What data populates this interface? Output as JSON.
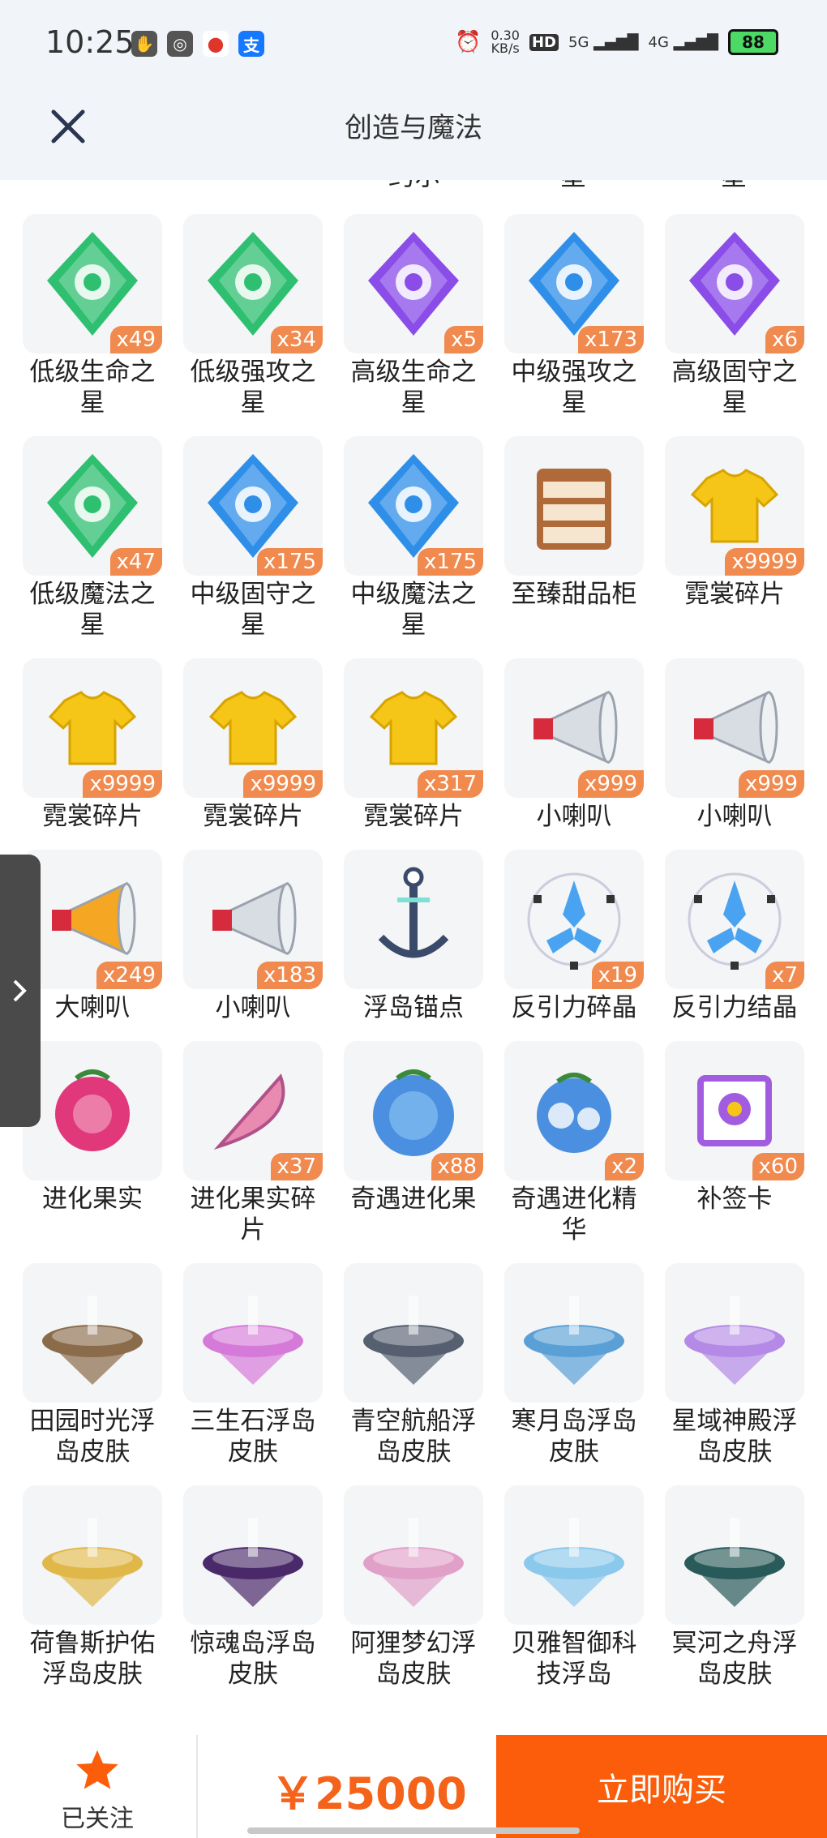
{
  "status_bar": {
    "time": "10:25",
    "net_speed": "0.30",
    "net_unit": "KB/s",
    "hd": "HD",
    "signal_5g": "5G",
    "signal_4g": "4G",
    "battery": "88",
    "left_icons": [
      "notification-hand-icon",
      "app-icon",
      "weibo-icon",
      "alipay-icon"
    ],
    "alipay_char": "支"
  },
  "header": {
    "title": "创造与魔法"
  },
  "partial_labels": [
    "约尔",
    "星",
    "星"
  ],
  "items": [
    {
      "label": "低级生命之\n星",
      "qty": "x49",
      "icon": "green-gem-heart-icon",
      "color": "#2fbf71"
    },
    {
      "label": "低级强攻之\n星",
      "qty": "x34",
      "icon": "green-gem-shield-icon",
      "color": "#2fbf71"
    },
    {
      "label": "高级生命之\n星",
      "qty": "x5",
      "icon": "purple-gem-heart-icon",
      "color": "#8a4de8"
    },
    {
      "label": "中级强攻之\n星",
      "qty": "x173",
      "icon": "blue-gem-shield-icon",
      "color": "#2f8fe8"
    },
    {
      "label": "高级固守之\n星",
      "qty": "x6",
      "icon": "purple-gem-shield-icon",
      "color": "#8a4de8"
    },
    {
      "label": "低级魔法之\n星",
      "qty": "x47",
      "icon": "green-gem-circle-icon",
      "color": "#2fbf71"
    },
    {
      "label": "中级固守之\n星",
      "qty": "x175",
      "icon": "blue-gem-shield-icon",
      "color": "#2f8fe8"
    },
    {
      "label": "中级魔法之\n星",
      "qty": "x175",
      "icon": "blue-gem-circle-icon",
      "color": "#2f8fe8"
    },
    {
      "label": "至臻甜品柜",
      "qty": "",
      "icon": "dessert-cabinet-icon",
      "color": "#b06a3a"
    },
    {
      "label": "霓裳碎片",
      "qty": "x9999",
      "icon": "yellow-shirt-icon",
      "color": "#f5c518"
    },
    {
      "label": "霓裳碎片",
      "qty": "x9999",
      "icon": "yellow-shirt-icon",
      "color": "#f5c518"
    },
    {
      "label": "霓裳碎片",
      "qty": "x9999",
      "icon": "yellow-shirt-icon",
      "color": "#f5c518"
    },
    {
      "label": "霓裳碎片",
      "qty": "x317",
      "icon": "yellow-shirt-icon",
      "color": "#f5c518"
    },
    {
      "label": "小喇叭",
      "qty": "x999",
      "icon": "megaphone-icon",
      "color": "#d8dde3"
    },
    {
      "label": "小喇叭",
      "qty": "x999",
      "icon": "megaphone-icon",
      "color": "#d8dde3"
    },
    {
      "label": "大喇叭",
      "qty": "x249",
      "icon": "rainbow-megaphone-icon",
      "color": "#f5a623"
    },
    {
      "label": "小喇叭",
      "qty": "x183",
      "icon": "megaphone-icon",
      "color": "#d8dde3"
    },
    {
      "label": "浮岛锚点",
      "qty": "",
      "icon": "anchor-icon",
      "color": "#3a4a6a"
    },
    {
      "label": "反引力碎晶",
      "qty": "x19",
      "icon": "antigravity-shard-icon",
      "color": "#4aa3f0"
    },
    {
      "label": "反引力结晶",
      "qty": "x7",
      "icon": "antigravity-crystal-icon",
      "color": "#4aa3f0"
    },
    {
      "label": "进化果实",
      "qty": "",
      "icon": "raspberry-fruit-icon",
      "color": "#e0387a"
    },
    {
      "label": "进化果实碎\n片",
      "qty": "x37",
      "icon": "fruit-slice-icon",
      "color": "#e98ab0"
    },
    {
      "label": "奇遇进化果",
      "qty": "x88",
      "icon": "blue-fruit-icon",
      "color": "#4a8fe0"
    },
    {
      "label": "奇遇进化精\n华",
      "qty": "x2",
      "icon": "blue-fruit-essence-icon",
      "color": "#4a8fe0"
    },
    {
      "label": "补签卡",
      "qty": "x60",
      "icon": "sign-card-icon",
      "color": "#a25ce0"
    },
    {
      "label": "田园时光浮\n岛皮肤",
      "qty": "",
      "icon": "island-lighthouse-icon",
      "color": "#8a6b4a"
    },
    {
      "label": "三生石浮岛\n皮肤",
      "qty": "",
      "icon": "island-blossom-icon",
      "color": "#d67ad9"
    },
    {
      "label": "青空航船浮\n岛皮肤",
      "qty": "",
      "icon": "island-ship-icon",
      "color": "#556070"
    },
    {
      "label": "寒月岛浮岛\n皮肤",
      "qty": "",
      "icon": "island-moon-icon",
      "color": "#5aa0d6"
    },
    {
      "label": "星域神殿浮\n岛皮肤",
      "qty": "",
      "icon": "island-temple-icon",
      "color": "#b48ae6"
    },
    {
      "label": "荷鲁斯护佑\n浮岛皮肤",
      "qty": "",
      "icon": "island-horus-icon",
      "color": "#e0b84a"
    },
    {
      "label": "惊魂岛浮岛\n皮肤",
      "qty": "",
      "icon": "island-haunted-icon",
      "color": "#4a2a6a"
    },
    {
      "label": "阿狸梦幻浮\n岛皮肤",
      "qty": "",
      "icon": "island-dream-icon",
      "color": "#e0a0c8"
    },
    {
      "label": "贝雅智御科\n技浮岛",
      "qty": "",
      "icon": "island-dome-icon",
      "color": "#8ac8ec"
    },
    {
      "label": "冥河之舟浮\n岛皮肤",
      "qty": "",
      "icon": "island-styx-icon",
      "color": "#2a5a5a"
    }
  ],
  "bottom_bar": {
    "follow_label": "已关注",
    "price": "￥25000",
    "buy_label": "立即购买",
    "accent": "#fb5d0a"
  }
}
